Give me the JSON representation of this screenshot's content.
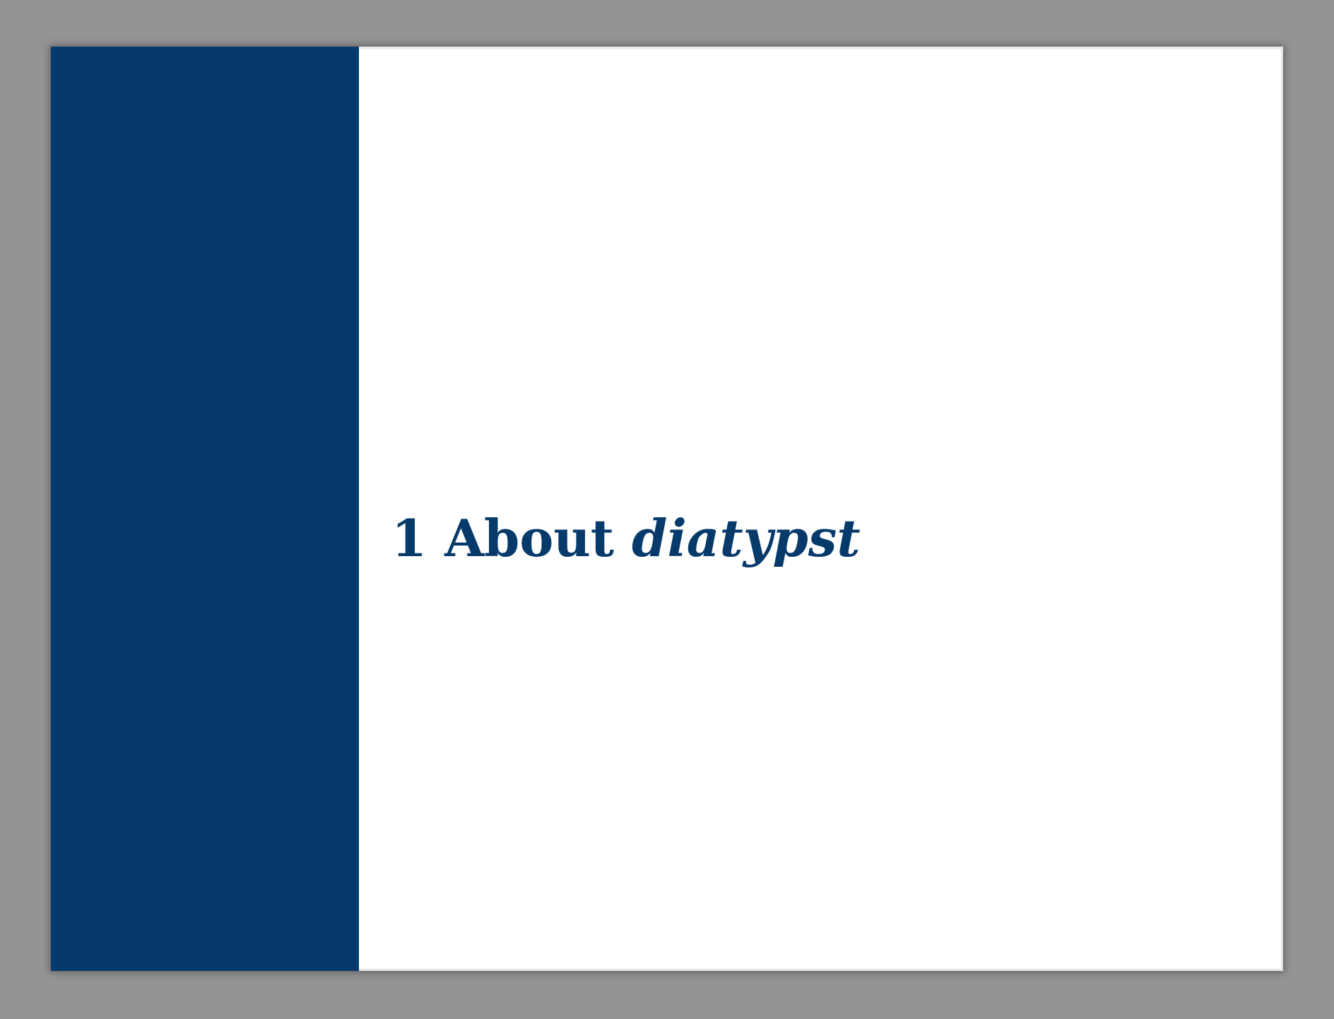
{
  "colors": {
    "viewer_background": "#949494",
    "accent": "#053a6b",
    "page_background": "#ffffff"
  },
  "page": {
    "chapter_number": "1",
    "heading_plain": "About",
    "heading_emphasis": "diatypst"
  }
}
